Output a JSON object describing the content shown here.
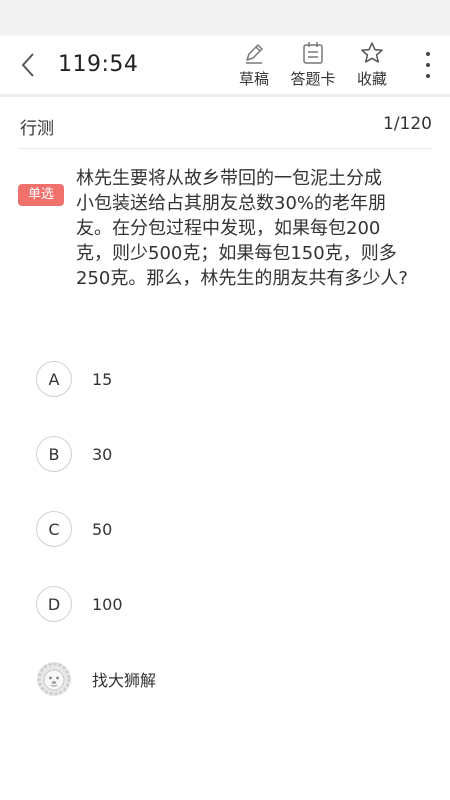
{
  "header": {
    "timer": "119:54",
    "tools": [
      {
        "label": "草稿",
        "icon": "pencil-icon"
      },
      {
        "label": "答题卡",
        "icon": "answer-card-icon"
      },
      {
        "label": "收藏",
        "icon": "star-icon"
      }
    ]
  },
  "subject": {
    "name": "行测",
    "progress": "1/120"
  },
  "question": {
    "type": "单选",
    "lines": [
      "林先生要将从故乡带回的一包泥土分成",
      "小包装送给占其朋友总数30%的老年朋",
      "友。在分包过程中发现，如果每包200",
      "克，则少500克；如果每包150克，则多",
      "250克。那么，林先生的朋友共有多少人?"
    ]
  },
  "options": [
    {
      "letter": "A",
      "text": "15"
    },
    {
      "letter": "B",
      "text": "30"
    },
    {
      "letter": "C",
      "text": "50"
    },
    {
      "letter": "D",
      "text": "100"
    }
  ],
  "helper": {
    "label": "找大狮解",
    "icon": "lion-avatar-icon"
  }
}
